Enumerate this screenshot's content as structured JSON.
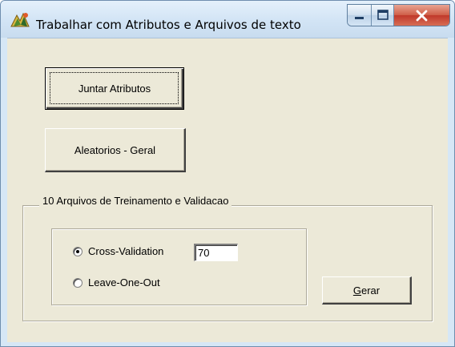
{
  "window": {
    "title": "Trabalhar com Atributos e Arquivos de texto",
    "icon": "app-icon",
    "controls": [
      "minimize-icon",
      "maximize-icon",
      "close-icon"
    ]
  },
  "buttons": {
    "juntar_label": "Juntar Atributos",
    "aleatorios_label": "Aleatorios - Geral",
    "gerar_mnemonic": "G",
    "gerar_rest": "erar"
  },
  "group": {
    "legend": "10 Arquivos de Treinamento e Validacao",
    "options": [
      {
        "label": "Cross-Validation",
        "selected": true
      },
      {
        "label": "Leave-One-Out",
        "selected": false
      }
    ],
    "value_field": {
      "value": "70"
    }
  },
  "colors": {
    "face": "#ece9d8",
    "frame": "#d6e7f6",
    "close_button": "#c0392b"
  }
}
